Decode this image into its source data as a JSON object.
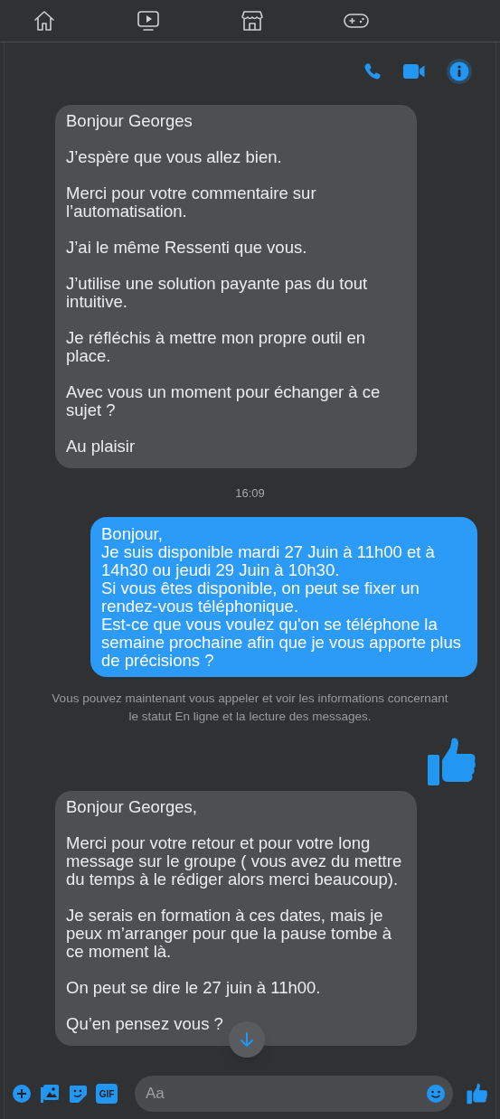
{
  "messages": [
    {
      "kind": "incoming",
      "paragraphs": [
        "Bonjour Georges",
        "J’espère que vous allez bien.",
        "Merci pour votre commentaire sur l’automatisation.",
        "J’ai le même Ressenti que vous.",
        "J’utilise une solution payante pas du tout intuitive.",
        "Je réfléchis à mettre mon propre outil en place.",
        "Avec vous un moment pour échanger à ce sujet ?",
        "Au plaisir"
      ]
    },
    {
      "kind": "time",
      "text": "16:09"
    },
    {
      "kind": "outgoing",
      "paragraphs": [
        "Bonjour,\nJe suis disponible mardi 27 Juin à 11h00 et à 14h30 ou jeudi 29 Juin à 10h30.\nSi vous êtes disponible, on peut se fixer un rendez-vous téléphonique.\nEst-ce que vous voulez qu'on se téléphone la semaine prochaine afin que je vous apporte plus de précisions ?"
      ]
    },
    {
      "kind": "notice",
      "text": "Vous pouvez maintenant vous appeler et voir les informations concernant le statut En ligne et la lecture des messages."
    },
    {
      "kind": "like"
    },
    {
      "kind": "incoming",
      "paragraphs": [
        "Bonjour Georges,",
        "Merci pour votre retour et pour votre long message sur le groupe ( vous avez du mettre du temps à le rédiger alors merci beaucoup).",
        "Je serais en formation à ces dates, mais je peux m’arranger pour que la pause tombe à ce moment là.",
        "On peut se dire le 27 juin à 11h00.",
        "Qu’en pensez vous ?"
      ]
    }
  ],
  "composer": {
    "gif_label": "GIF",
    "placeholder": "Aa"
  }
}
